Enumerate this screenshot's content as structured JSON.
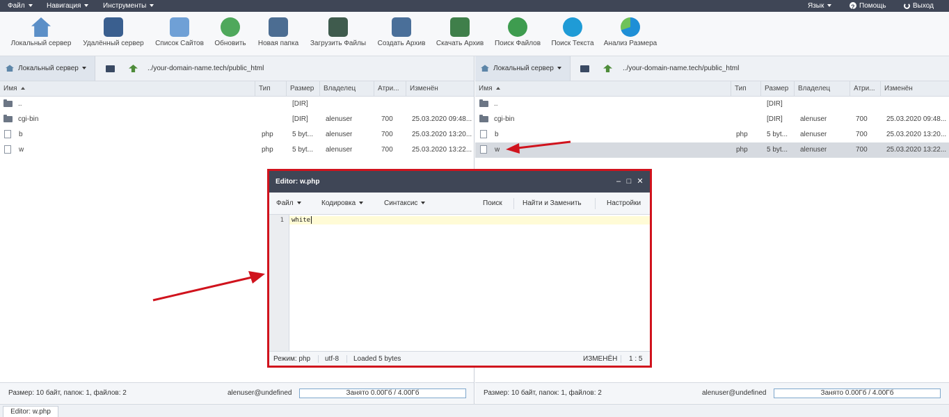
{
  "menubar": {
    "file": "Файл",
    "navigation": "Навигация",
    "tools": "Инструменты",
    "language": "Язык",
    "help": "Помощь",
    "logout": "Выход"
  },
  "toolbar": [
    {
      "label": "Локальный сервер",
      "icon": "local-server-icon"
    },
    {
      "label": "Удалённый сервер",
      "icon": "remote-server-icon"
    },
    {
      "label": "Список Сайтов",
      "icon": "site-list-icon"
    },
    {
      "label": "Обновить",
      "icon": "refresh-icon"
    },
    {
      "label": "Новая папка",
      "icon": "new-folder-icon"
    },
    {
      "label": "Загрузить Файлы",
      "icon": "upload-icon"
    },
    {
      "label": "Создать Архив",
      "icon": "archive-icon"
    },
    {
      "label": "Скачать Архив",
      "icon": "download-archive-icon"
    },
    {
      "label": "Поиск Файлов",
      "icon": "search-files-icon"
    },
    {
      "label": "Поиск Текста",
      "icon": "search-text-icon"
    },
    {
      "label": "Анализ Размера",
      "icon": "size-analysis-icon"
    }
  ],
  "left": {
    "site": "Локальный сервер",
    "path": "../your-domain-name.tech/public_html",
    "columns": [
      "Имя",
      "Тип",
      "Размер",
      "Владелец",
      "Атри...",
      "Изменён"
    ],
    "rows": [
      {
        "name": "..",
        "type": "",
        "size": "[DIR]",
        "owner": "",
        "attr": "",
        "modified": ""
      },
      {
        "name": "cgi-bin",
        "type": "",
        "size": "[DIR]",
        "owner": "alenuser",
        "attr": "700",
        "modified": "25.03.2020 09:48..."
      },
      {
        "name": "b",
        "type": "php",
        "size": "5 byt...",
        "owner": "alenuser",
        "attr": "700",
        "modified": "25.03.2020 13:20..."
      },
      {
        "name": "w",
        "type": "php",
        "size": "5 byt...",
        "owner": "alenuser",
        "attr": "700",
        "modified": "25.03.2020 13:22..."
      }
    ],
    "status": "Размер: 10 байт, папок: 1, файлов: 2",
    "user": "alenuser@undefined",
    "quota": "Занято 0.00Гб / 4.00Гб"
  },
  "right": {
    "site": "Локальный сервер",
    "path": "../your-domain-name.tech/public_html",
    "columns": [
      "Имя",
      "Тип",
      "Размер",
      "Владелец",
      "Атри...",
      "Изменён"
    ],
    "rows": [
      {
        "name": "..",
        "type": "",
        "size": "[DIR]",
        "owner": "",
        "attr": "",
        "modified": ""
      },
      {
        "name": "cgi-bin",
        "type": "",
        "size": "[DIR]",
        "owner": "alenuser",
        "attr": "700",
        "modified": "25.03.2020 09:48..."
      },
      {
        "name": "b",
        "type": "php",
        "size": "5 byt...",
        "owner": "alenuser",
        "attr": "700",
        "modified": "25.03.2020 13:20..."
      },
      {
        "name": "w",
        "type": "php",
        "size": "5 byt...",
        "owner": "alenuser",
        "attr": "700",
        "modified": "25.03.2020 13:22..."
      }
    ],
    "status": "Размер: 10 байт, папок: 1, файлов: 2",
    "user": "alenuser@undefined",
    "quota": "Занято 0.00Гб / 4.00Гб"
  },
  "editor": {
    "title": "Editor: w.php",
    "menu": {
      "file": "Файл",
      "encoding": "Кодировка",
      "syntax": "Синтаксис",
      "search": "Поиск",
      "replace": "Найти и Заменить",
      "settings": "Настройки"
    },
    "line_number": "1",
    "code": "white",
    "status": {
      "mode": "Режим: php",
      "encoding": "utf-8",
      "loaded": "Loaded 5 bytes",
      "state": "ИЗМЕНЁН",
      "position": "1 : 5"
    }
  },
  "taskbar": {
    "tab": "Editor: w.php"
  },
  "colors": {
    "highlight": "#d0131d",
    "menubar": "#3f4656"
  }
}
